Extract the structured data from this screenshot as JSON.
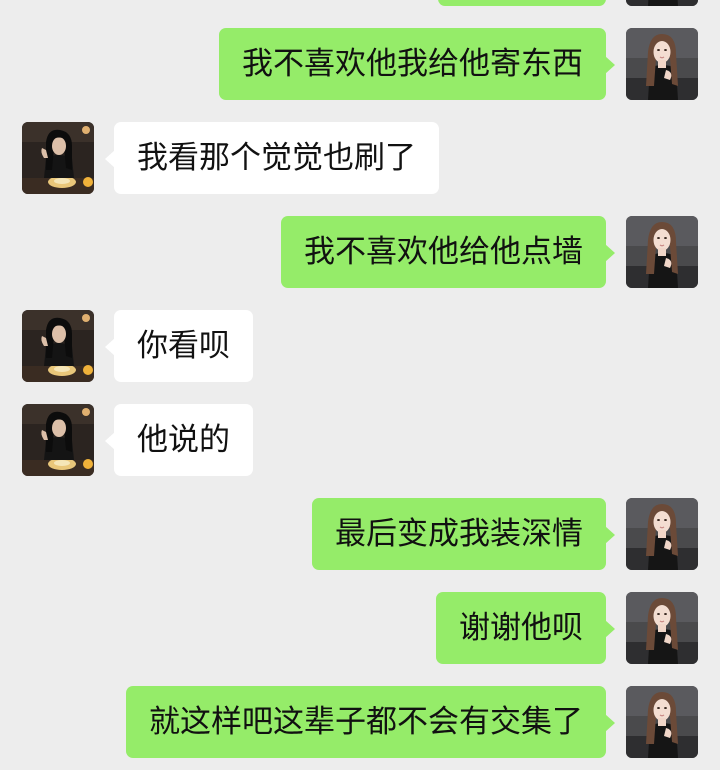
{
  "colors": {
    "background": "#ededed",
    "sent_bubble": "#95ec69",
    "received_bubble": "#ffffff",
    "text": "#111111"
  },
  "messages": [
    {
      "side": "right",
      "text": "",
      "avatar": "self-avatar-icon"
    },
    {
      "side": "right",
      "text": "我不喜欢他我给他寄东西",
      "avatar": "self-avatar-icon"
    },
    {
      "side": "left",
      "text": "我看那个觉觉也刷了",
      "avatar": "contact-avatar-icon"
    },
    {
      "side": "right",
      "text": "我不喜欢他给他点墙",
      "avatar": "self-avatar-icon"
    },
    {
      "side": "left",
      "text": "你看呗",
      "avatar": "contact-avatar-icon"
    },
    {
      "side": "left",
      "text": "他说的",
      "avatar": "contact-avatar-icon"
    },
    {
      "side": "right",
      "text": "最后变成我装深情",
      "avatar": "self-avatar-icon"
    },
    {
      "side": "right",
      "text": "谢谢他呗",
      "avatar": "self-avatar-icon"
    },
    {
      "side": "right",
      "text": "就这样吧这辈子都不会有交集了",
      "avatar": "self-avatar-icon"
    }
  ]
}
